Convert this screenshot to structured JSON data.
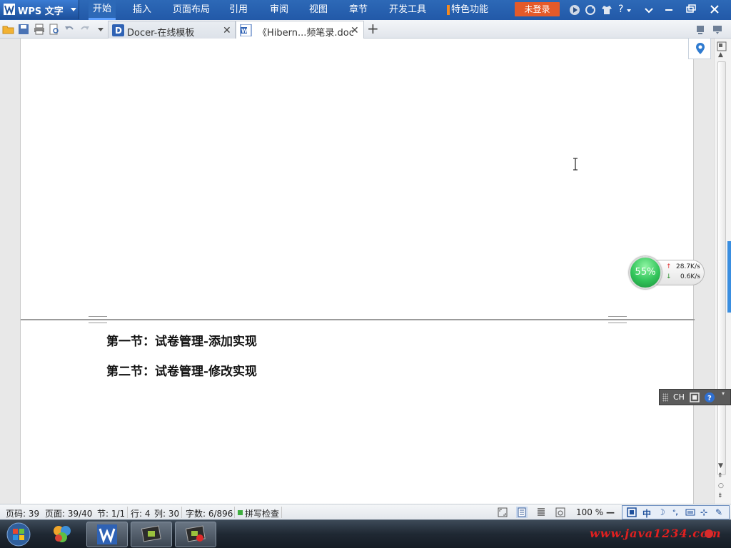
{
  "app": {
    "title": "WPS 文字"
  },
  "menu": {
    "items": [
      "开始",
      "插入",
      "页面布局",
      "引用",
      "审阅",
      "视图",
      "章节",
      "开发工具"
    ],
    "feature_label": "特色功能",
    "login_label": "未登录",
    "help_label": "?"
  },
  "tabs": [
    {
      "label": "Docer-在线模板",
      "icon": "docer-icon"
    },
    {
      "label": "《Hibern...频笔录.doc",
      "icon": "wps-doc-icon"
    }
  ],
  "document": {
    "headings": [
      "第一节：试卷管理-添加实现",
      "第二节：试卷管理-修改实现"
    ]
  },
  "speed_widget": {
    "percent": "55%",
    "upload": "28.7K/s",
    "download": "0.6K/s",
    "color": "#32c45a"
  },
  "ime_bar": {
    "mode": "CH"
  },
  "status": {
    "page_no": "页码: 39",
    "pages": "页面: 39/40",
    "section": "节: 1/1",
    "row": "行: 4",
    "col": "列: 30",
    "words": "字数: 6/896",
    "spell": "拼写检查",
    "zoom": "100 %",
    "zoom_minus": "—"
  },
  "ime_tray": {
    "zh": "中"
  },
  "taskbar": {
    "watermark": "www.java1234.com"
  },
  "colors": {
    "menubar": "#2259a8",
    "login": "#e45a2a",
    "feature_accent": "#f58a1f",
    "watermark": "#e02020"
  }
}
